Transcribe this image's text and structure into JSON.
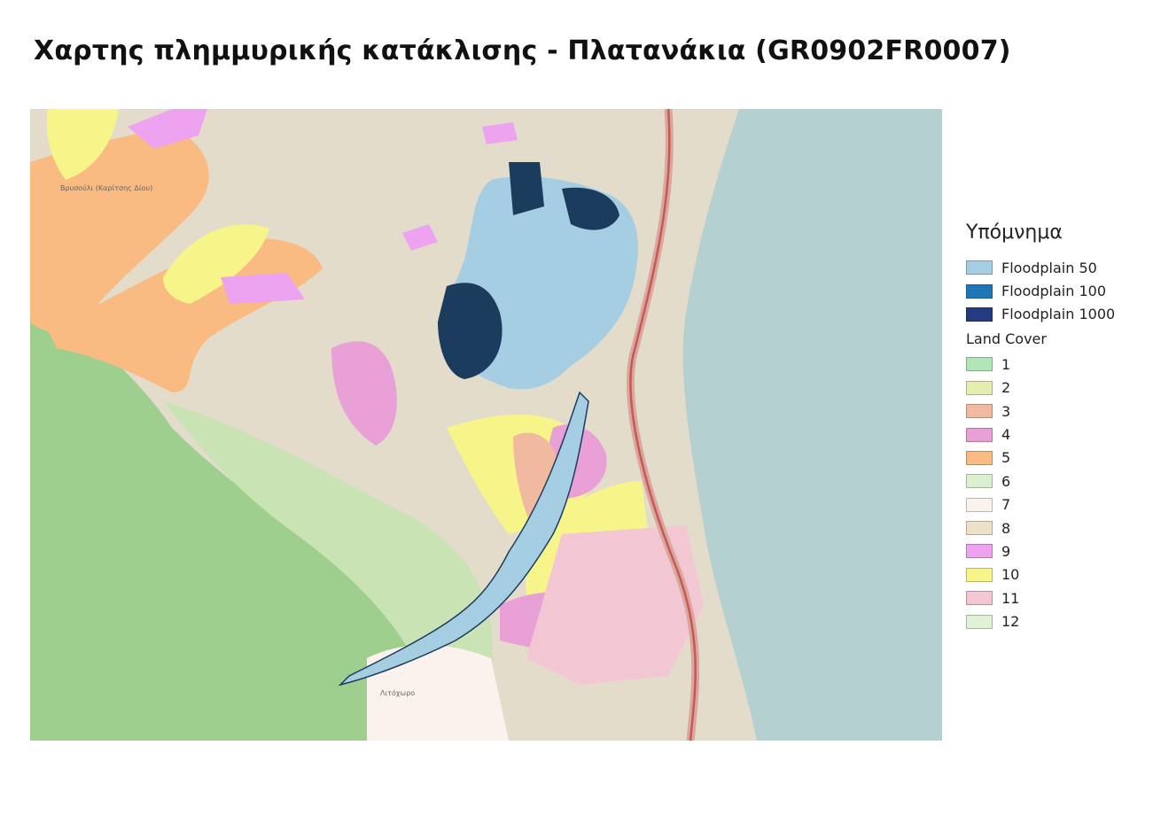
{
  "title": "Χαρτης πλημμυρικής κατάκλισης - Πλατανάκια (GR0902FR0007)",
  "map": {
    "labels": {
      "village_north": "Βρυσούλι (Καρίτσης Δίου)",
      "village_south": "Λιτόχωρο"
    }
  },
  "legend": {
    "title": "Υπόμνημα",
    "floodplains": [
      {
        "label": "Floodplain 50",
        "color": "#a6cee3"
      },
      {
        "label": "Floodplain 100",
        "color": "#1f78b4"
      },
      {
        "label": "Floodplain 1000",
        "color": "#253b7f"
      }
    ],
    "land_cover_title": "Land Cover",
    "land_cover": [
      {
        "label": "1",
        "color": "#b2e6b8"
      },
      {
        "label": "2",
        "color": "#e6edb0"
      },
      {
        "label": "3",
        "color": "#f0b9a0"
      },
      {
        "label": "4",
        "color": "#e8a0d6"
      },
      {
        "label": "5",
        "color": "#f9bb82"
      },
      {
        "label": "6",
        "color": "#dcf0d0"
      },
      {
        "label": "7",
        "color": "#fbf2ee"
      },
      {
        "label": "8",
        "color": "#ece2c9"
      },
      {
        "label": "9",
        "color": "#eda3f0"
      },
      {
        "label": "10",
        "color": "#f7f58a"
      },
      {
        "label": "11",
        "color": "#f2c6d2"
      },
      {
        "label": "12",
        "color": "#dff2d6"
      }
    ]
  }
}
